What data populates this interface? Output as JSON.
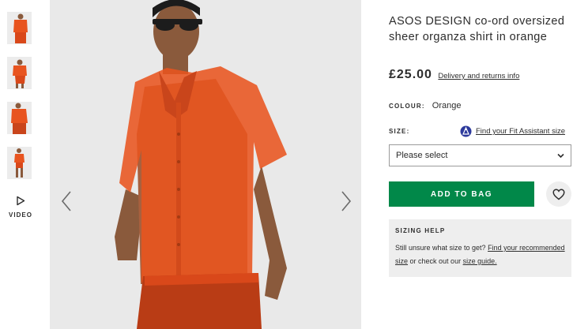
{
  "gallery": {
    "thumbnails": [
      {
        "label": "thumbnail-1"
      },
      {
        "label": "thumbnail-2"
      },
      {
        "label": "thumbnail-3"
      },
      {
        "label": "thumbnail-4"
      }
    ],
    "video_label": "VIDEO",
    "video_icon": "play-icon",
    "prev_icon": "chevron-left-icon",
    "next_icon": "chevron-right-icon"
  },
  "product": {
    "title": "ASOS DESIGN co-ord oversized sheer organza shirt in orange",
    "price": "£25.00",
    "delivery_link": "Delivery and returns info",
    "colour_label": "COLOUR:",
    "colour_value": "Orange",
    "size_label": "SIZE:",
    "fit_assistant_link": "Find your Fit Assistant size",
    "fit_icon": "fit-assistant-icon",
    "size_select_value": "Please select",
    "add_to_bag_label": "ADD TO BAG",
    "save_icon": "heart-icon"
  },
  "sizing_help": {
    "heading": "SIZING HELP",
    "text_1": "Still unsure what size to get?",
    "link_1": "Find your recommended size",
    "text_2": "or check out our",
    "link_2": "size guide."
  },
  "colors": {
    "add_to_bag": "#018849",
    "shirt": "#e8541f",
    "text": "#2d2d2d",
    "fit_icon": "#2d3a9c"
  }
}
